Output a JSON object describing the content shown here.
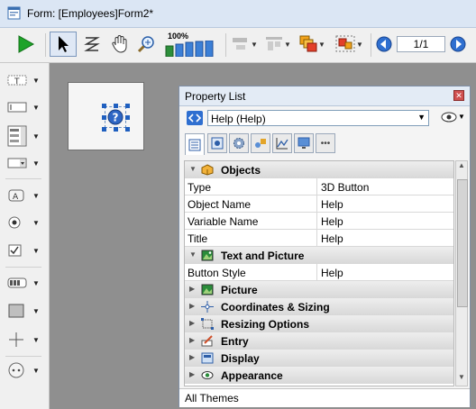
{
  "window": {
    "title": "Form: [Employees]Form2*"
  },
  "toolbar": {
    "zoom_label": "100%",
    "page_counter": "1/1"
  },
  "palette": {
    "items": [
      "text-tool",
      "field-tool",
      "list-tool",
      "combo-tool",
      "button-tool",
      "radio-tool",
      "checkbox-tool",
      "ruler-tool",
      "rectangle-tool",
      "line-tool",
      "plugin-tool"
    ]
  },
  "property_list": {
    "title": "Property List",
    "object_selector": "Help (Help)",
    "tabs": [
      "all-properties",
      "objects-tab",
      "settings-tab",
      "shapes-tab",
      "chart-tab",
      "display-tab",
      "more-tab"
    ],
    "groups": {
      "objects": "Objects",
      "text_picture": "Text and Picture",
      "picture": "Picture",
      "coordinates": "Coordinates & Sizing",
      "resizing": "Resizing Options",
      "entry": "Entry",
      "display": "Display",
      "appearance": "Appearance"
    },
    "props": {
      "type": {
        "name": "Type",
        "value": "3D Button"
      },
      "object_name": {
        "name": "Object Name",
        "value": "Help"
      },
      "variable_name": {
        "name": "Variable Name",
        "value": "Help"
      },
      "title": {
        "name": "Title",
        "value": "Help"
      },
      "button_style": {
        "name": "Button Style",
        "value": "Help"
      }
    },
    "footer": "All Themes"
  }
}
